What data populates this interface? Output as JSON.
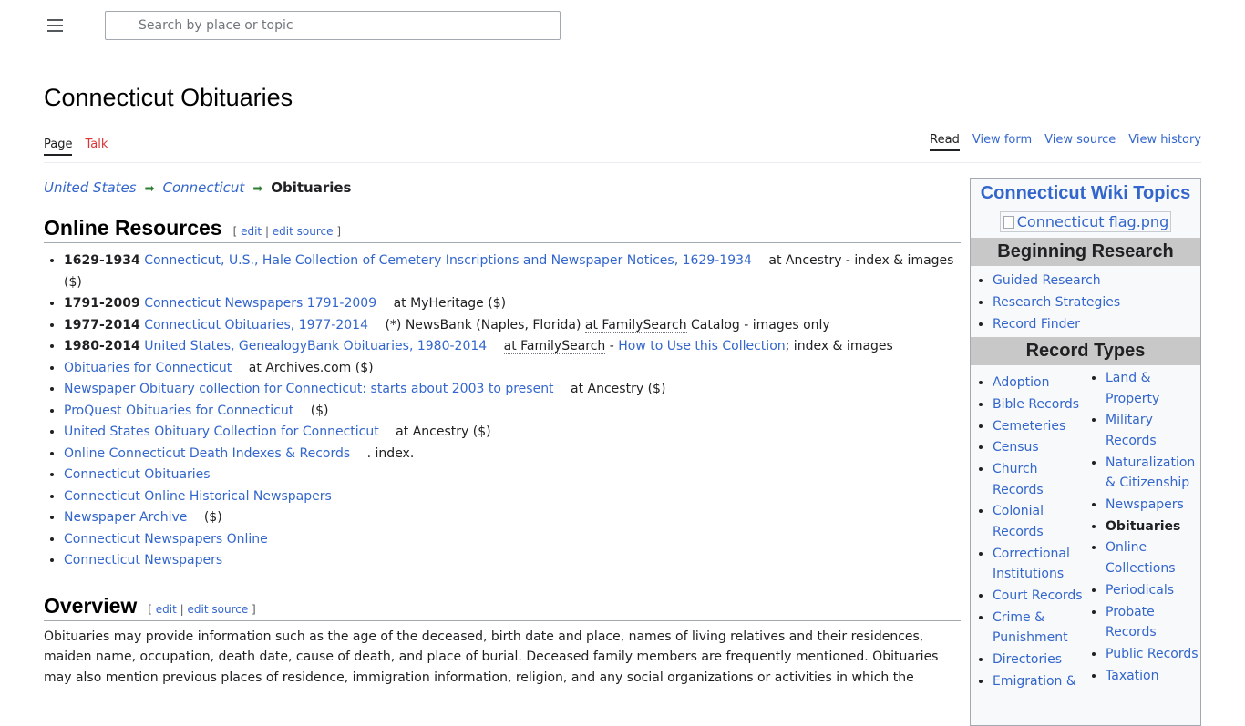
{
  "search": {
    "placeholder": "Search by place or topic"
  },
  "page": {
    "title": "Connecticut Obituaries"
  },
  "tabs": {
    "left": [
      "Page",
      "Talk"
    ],
    "right": [
      "Read",
      "View form",
      "View source",
      "View history"
    ]
  },
  "breadcrumb": {
    "items": [
      "United States",
      "Connecticut"
    ],
    "current": "Obituaries",
    "arrow": "➡"
  },
  "edit": {
    "edit": "edit",
    "edit_source": "edit source"
  },
  "online_resources": {
    "heading": "Online Resources",
    "items": [
      {
        "years": "1629-1934",
        "link": "Connecticut, U.S., Hale Collection of Cemetery Inscriptions and Newspaper Notices, 1629-1934",
        "after": "at Ancestry - index & images ($)"
      },
      {
        "years": "1791-2009",
        "link": "Connecticut Newspapers 1791-2009",
        "after": "at MyHeritage ($)"
      },
      {
        "years": "1977-2014",
        "link": "Connecticut Obituaries, 1977-2014",
        "after": "(*) NewsBank (Naples, Florida)",
        "at_fs": "at FamilySearch",
        "after2": "Catalog - images only"
      },
      {
        "years": "1980-2014",
        "link": "United States, GenealogyBank Obituaries, 1980-2014",
        "at_fs": "at FamilySearch",
        "dash": "-",
        "link2": "How to Use this Collection",
        "after2": "; index & images"
      },
      {
        "link": "Obituaries for Connecticut",
        "after": "at Archives.com ($)"
      },
      {
        "link": "Newspaper Obituary collection for Connecticut: starts about 2003 to present",
        "after": "at Ancestry ($)"
      },
      {
        "link": "ProQuest Obituaries for Connecticut",
        "after": "($)"
      },
      {
        "link": "United States Obituary Collection for Connecticut",
        "after": "at Ancestry ($)"
      },
      {
        "link": "Online Connecticut Death Indexes & Records",
        "after": ". index."
      },
      {
        "link": "Connecticut Obituaries"
      },
      {
        "link": "Connecticut Online Historical Newspapers"
      },
      {
        "link": "Newspaper Archive",
        "after": "($)"
      },
      {
        "link": "Connecticut Newspapers Online"
      },
      {
        "link": "Connecticut Newspapers"
      }
    ]
  },
  "overview": {
    "heading": "Overview",
    "text": "Obituaries may provide information such as the age of the deceased, birth date and place, names of living relatives and their residences, maiden name, occupation, death date, cause of death, and place of burial. Deceased family members are frequently mentioned. Obituaries may also mention previous places of residence, immigration information, religion, and any social organizations or activities in which the"
  },
  "sidebar": {
    "title": "Connecticut Wiki Topics",
    "flag_alt": "Connecticut flag.png",
    "beginning": {
      "heading": "Beginning Research",
      "items": [
        "Guided Research",
        "Research Strategies",
        "Record Finder"
      ]
    },
    "record_types": {
      "heading": "Record Types",
      "col1": [
        "Adoption",
        "Bible Records",
        "Cemeteries",
        "Census",
        "Church Records",
        "Colonial Records",
        "Correctional Institutions",
        "Court Records",
        "Crime & Punishment",
        "Directories",
        "Emigration &"
      ],
      "col2": [
        "Land & Property",
        "Military Records",
        "Naturalization & Citizenship",
        "Newspapers",
        "Obituaries",
        "Online Collections",
        "Periodicals",
        "Probate Records",
        "Public Records",
        "Taxation"
      ],
      "current": "Obituaries"
    }
  },
  "colors": {
    "link": "#3366cc",
    "new_link": "#dd3333",
    "arrow": "#2e7d32",
    "sidebar_header_bg": "#c8c8c8"
  }
}
